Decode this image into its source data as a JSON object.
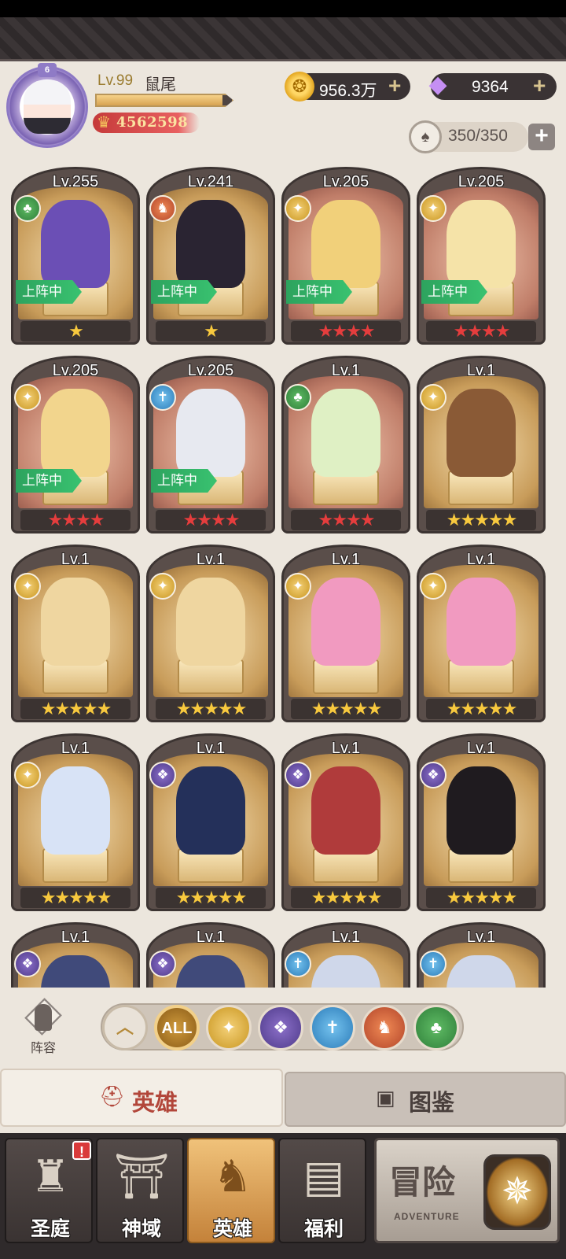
{
  "header": {
    "avatar_badge": "6",
    "level": "Lv.99",
    "player_name": "鼠尾",
    "xp_progress": 0.93,
    "power": "4562598",
    "gold": "956.3万",
    "gems": "9364",
    "stamina": "350/350"
  },
  "heroes": [
    {
      "level": "Lv.255",
      "faction": "nature",
      "deployed": true,
      "stars": "★",
      "star_style": "purple",
      "bg": "gold"
    },
    {
      "level": "Lv.241",
      "faction": "beast",
      "deployed": true,
      "stars": "★",
      "star_style": "purple",
      "bg": "gold"
    },
    {
      "level": "Lv.205",
      "faction": "light",
      "deployed": true,
      "stars": "★★★★",
      "star_style": "red",
      "bg": "red"
    },
    {
      "level": "Lv.205",
      "faction": "light",
      "deployed": true,
      "stars": "★★★★",
      "star_style": "red",
      "bg": "red"
    },
    {
      "level": "Lv.205",
      "faction": "light",
      "deployed": true,
      "stars": "★★★★",
      "star_style": "red",
      "bg": "red"
    },
    {
      "level": "Lv.205",
      "faction": "holy",
      "deployed": true,
      "stars": "★★★★",
      "star_style": "red",
      "bg": "red"
    },
    {
      "level": "Lv.1",
      "faction": "nature",
      "deployed": false,
      "stars": "★★★★",
      "star_style": "red",
      "bg": "red"
    },
    {
      "level": "Lv.1",
      "faction": "light",
      "deployed": false,
      "stars": "★★★★★",
      "star_style": "gold",
      "bg": "gold"
    },
    {
      "level": "Lv.1",
      "faction": "light",
      "deployed": false,
      "stars": "★★★★★",
      "star_style": "gold",
      "bg": "gold"
    },
    {
      "level": "Lv.1",
      "faction": "light",
      "deployed": false,
      "stars": "★★★★★",
      "star_style": "gold",
      "bg": "gold"
    },
    {
      "level": "Lv.1",
      "faction": "light",
      "deployed": false,
      "stars": "★★★★★",
      "star_style": "gold",
      "bg": "gold"
    },
    {
      "level": "Lv.1",
      "faction": "light",
      "deployed": false,
      "stars": "★★★★★",
      "star_style": "gold",
      "bg": "gold"
    },
    {
      "level": "Lv.1",
      "faction": "light",
      "deployed": false,
      "stars": "★★★★★",
      "star_style": "gold",
      "bg": "gold"
    },
    {
      "level": "Lv.1",
      "faction": "dark",
      "deployed": false,
      "stars": "★★★★★",
      "star_style": "gold",
      "bg": "gold"
    },
    {
      "level": "Lv.1",
      "faction": "dark",
      "deployed": false,
      "stars": "★★★★★",
      "star_style": "gold",
      "bg": "gold"
    },
    {
      "level": "Lv.1",
      "faction": "dark",
      "deployed": false,
      "stars": "★★★★★",
      "star_style": "gold",
      "bg": "gold"
    },
    {
      "level": "Lv.1",
      "faction": "dark",
      "deployed": false,
      "stars": "",
      "star_style": "gold",
      "bg": "gold"
    },
    {
      "level": "Lv.1",
      "faction": "dark",
      "deployed": false,
      "stars": "",
      "star_style": "gold",
      "bg": "gold"
    },
    {
      "level": "Lv.1",
      "faction": "holy",
      "deployed": false,
      "stars": "",
      "star_style": "gold",
      "bg": "gold"
    },
    {
      "level": "Lv.1",
      "faction": "holy",
      "deployed": false,
      "stars": "",
      "star_style": "gold",
      "bg": "gold"
    }
  ],
  "deploy_label": "上阵中",
  "formation_label": "阵容",
  "filters": [
    {
      "id": "sort",
      "label": "︿"
    },
    {
      "id": "all",
      "label": "ALL"
    },
    {
      "id": "light",
      "label": "✦"
    },
    {
      "id": "dark",
      "label": "❖"
    },
    {
      "id": "holy",
      "label": "✝"
    },
    {
      "id": "beast",
      "label": "♞"
    },
    {
      "id": "nature",
      "label": "♣"
    }
  ],
  "tabs": {
    "heroes": "英雄",
    "codex": "图鉴"
  },
  "nav": [
    {
      "label": "圣庭",
      "alert": "!"
    },
    {
      "label": "神域"
    },
    {
      "label": "英雄"
    },
    {
      "label": "福利"
    }
  ],
  "adventure": {
    "title": "冒险",
    "subtitle": "ADVENTURE"
  },
  "colors": {
    "accent_gold": "#c4823a",
    "deploy_green": "#2da35e",
    "power_red": "#c53a3a"
  }
}
